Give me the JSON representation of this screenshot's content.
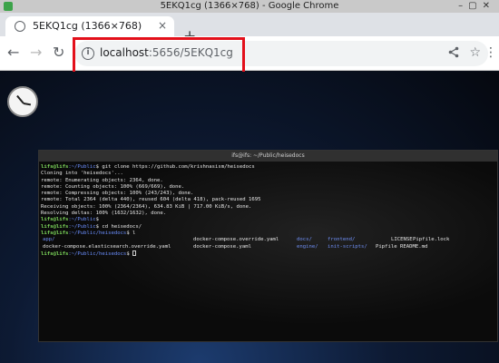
{
  "window": {
    "title": "5EKQ1cg (1366×768) - Google Chrome"
  },
  "tabs": [
    {
      "title": "5EKQ1cg (1366×768)",
      "close": "×"
    }
  ],
  "new_tab": "+",
  "toolbar": {
    "back": "←",
    "forward": "→",
    "reload": "↻",
    "url_host": "localhost",
    "url_path": ":5656/5EKQ1cg",
    "menu": "⋮"
  },
  "terminal": {
    "title": "ifs@ifs: ~/Public/heisedocs",
    "prompt_user": "lifs@lifs",
    "lines": [
      {
        "path": ":~/Public",
        "cmd": "$ git clone https://github.com/krishnasism/heisedocs"
      },
      {
        "text": "Cloning into 'heisedocs'..."
      },
      {
        "text": "remote: Enumerating objects: 2364, done."
      },
      {
        "text": "remote: Counting objects: 100% (669/669), done."
      },
      {
        "text": "remote: Compressing objects: 100% (243/243), done."
      },
      {
        "text": "remote: Total 2364 (delta 440), reused 604 (delta 418), pack-reused 1695"
      },
      {
        "text": "Receiving objects: 100% (2364/2364), 634.83 KiB | 717.00 KiB/s, done."
      },
      {
        "text": "Resolving deltas: 100% (1632/1632), done."
      },
      {
        "path": ":~/Public",
        "cmd": "$"
      },
      {
        "path": ":~/Public",
        "cmd": "$ cd heisedocs/"
      },
      {
        "path": ":~/Public/heisedocs",
        "cmd": "$ l"
      }
    ],
    "ls_row1": [
      "app/",
      "docker-compose.override.yaml",
      "docs/",
      "frontend/",
      "LICENSE",
      "Pipfile.lock"
    ],
    "ls_row2": [
      "docker-compose.elasticsearch.override.yaml",
      "docker-compose.yaml",
      "engine/",
      "init-scripts/",
      "Pipfile",
      "README.md"
    ],
    "final_path": ":~/Public/heisedocs",
    "final_cmd": "$ "
  },
  "colors": {
    "highlight": "#e3101b",
    "prompt_user": "#7cd65a",
    "prompt_path": "#6b8fff"
  }
}
